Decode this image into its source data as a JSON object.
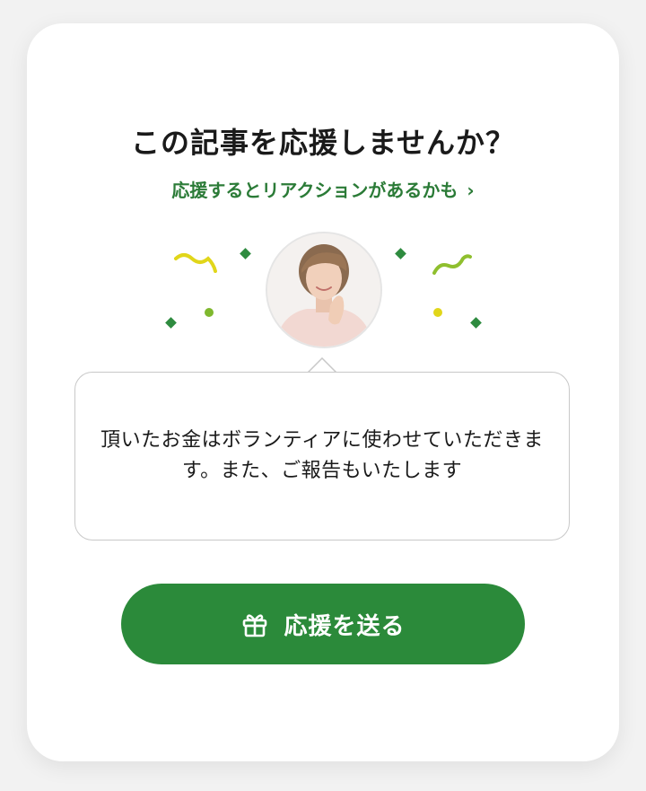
{
  "card": {
    "title": "この記事を応援しませんか？",
    "subtitle_link": "応援するとリアクションがあるかも",
    "subtitle_chevron": "›",
    "message": "頂いたお金はボランティアに使わせていただきます。また、ご報告もいたします",
    "send_button_label": "応援を送る",
    "send_button_icon": "gift-icon"
  },
  "colors": {
    "accent_green": "#2b8a3a",
    "link_green": "#2b7b37",
    "confetti_green": "#2e8b3f",
    "confetti_yellow": "#e1d61a",
    "confetti_lime": "#7fb82e"
  }
}
